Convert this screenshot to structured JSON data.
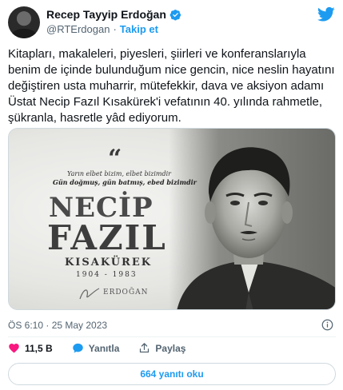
{
  "author": {
    "name": "Recep Tayyip Erdoğan",
    "handle": "@RTErdogan",
    "separator": "·",
    "follow_label": "Takip et"
  },
  "tweet": {
    "text": "Kitapları, makaleleri, piyesleri, şiirleri ve konferanslarıyla benim de içinde bulunduğum nice gencin, nice neslin hayatını değiştiren usta muharrir, mütefekkir, dava ve aksiyon adamı Üstat Necip Fazıl Kısakürek'i vefatının 40. yılında rahmetle, şükranla, hasretle yâd ediyorum.",
    "timestamp": "ÖS 6:10 · 25 May 2023"
  },
  "image": {
    "quote_mark": "“",
    "quote_line1": "Yarın elbet bizim, elbet bizimdir",
    "quote_line2": "Gün doğmuş, gün batmış, ebed bizimdir",
    "title_first": "NECİP",
    "title_second": "FAZIL",
    "title_last": "KISAKÜREK",
    "years": "1904 - 1983",
    "signature": "ERDOĞAN"
  },
  "actions": {
    "likes": "11,5 B",
    "reply_label": "Yanıtla",
    "share_label": "Paylaş"
  },
  "replies_button": "664 yanıtı oku",
  "colors": {
    "accent": "#1d9bf0",
    "like": "#f91880",
    "text": "#0f1419",
    "muted": "#536471"
  },
  "icons": [
    "verified-badge-icon",
    "twitter-bird-icon",
    "info-icon",
    "heart-icon",
    "reply-icon",
    "share-icon"
  ]
}
